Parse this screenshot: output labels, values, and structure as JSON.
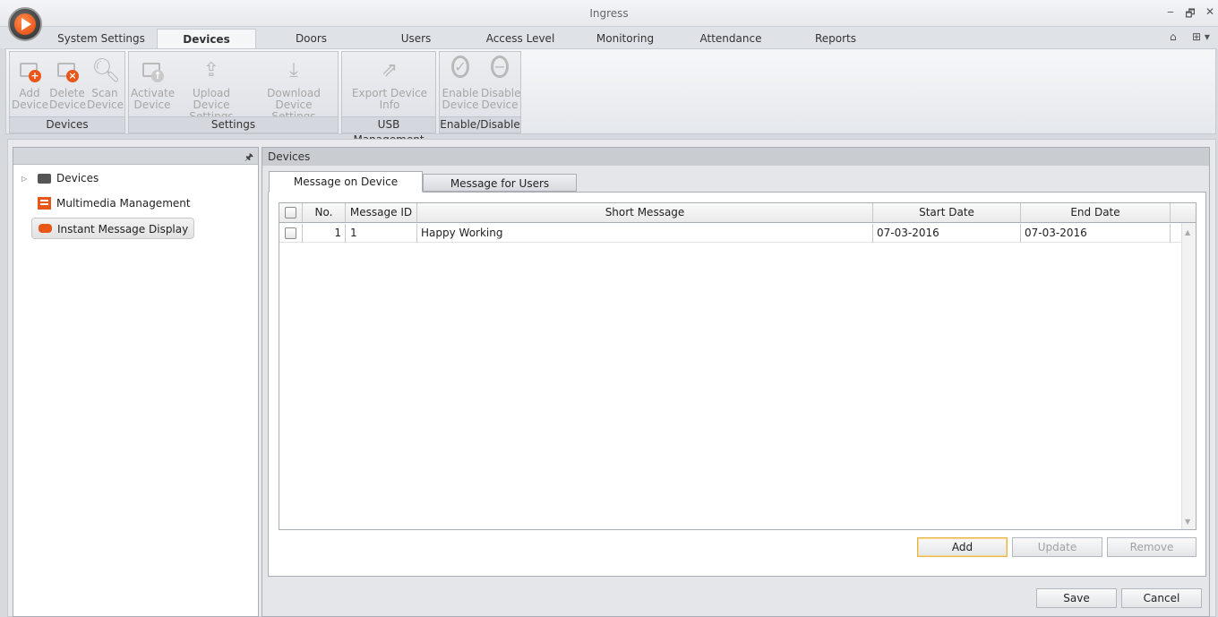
{
  "window": {
    "title": "Ingress",
    "minimize": "‒",
    "restore": "🗗",
    "close": "✕"
  },
  "ribbon_tabs": [
    "System Settings",
    "Devices",
    "Doors",
    "Users",
    "Access Level",
    "Monitoring",
    "Attendance",
    "Reports"
  ],
  "ribbon_tabs_active": "Devices",
  "ribbon_right": {
    "collapse": "⌂",
    "layout": "⊞ ▾"
  },
  "ribbon_groups": {
    "devices": {
      "label": "Devices",
      "buttons": [
        {
          "line1": "Add",
          "line2": "Device"
        },
        {
          "line1": "Delete",
          "line2": "Device"
        },
        {
          "line1": "Scan",
          "line2": "Device"
        }
      ]
    },
    "settings": {
      "label": "Settings",
      "buttons": [
        {
          "line1": "Activate",
          "line2": "Device"
        },
        {
          "line1": "Upload Device",
          "line2": "Settings"
        },
        {
          "line1": "Download Device",
          "line2": "Settings"
        }
      ]
    },
    "usb": {
      "label": "USB Management",
      "buttons": [
        {
          "line1": "Export Device",
          "line2": "Info"
        }
      ]
    },
    "enable": {
      "label": "Enable/Disable",
      "buttons": [
        {
          "line1": "Enable",
          "line2": "Device"
        },
        {
          "line1": "Disable",
          "line2": "Device"
        }
      ]
    }
  },
  "nav_tree": {
    "pin": "🖈",
    "items": [
      {
        "label": "Devices",
        "icon": "device-icon"
      },
      {
        "label": "Multimedia Management",
        "icon": "film-icon"
      },
      {
        "label": "Instant Message Display",
        "icon": "chat-icon"
      }
    ],
    "selected": "Instant Message Display"
  },
  "main": {
    "header": "Devices",
    "tabs": [
      "Message on Device",
      "Message for Users"
    ],
    "active_tab": "Message on Device",
    "table": {
      "columns": [
        "No.",
        "Message ID",
        "Short Message",
        "Start Date",
        "End Date"
      ],
      "rows": [
        {
          "no": "1",
          "message_id": "1",
          "short_message": "Happy Working",
          "start_date": "07-03-2016",
          "end_date": "07-03-2016"
        }
      ]
    },
    "actions": {
      "add": "Add",
      "update": "Update",
      "remove": "Remove"
    },
    "footer": {
      "save": "Save",
      "cancel": "Cancel"
    }
  },
  "colors": {
    "accent_orange": "#e8561a",
    "focus_border": "#e8b54d"
  }
}
